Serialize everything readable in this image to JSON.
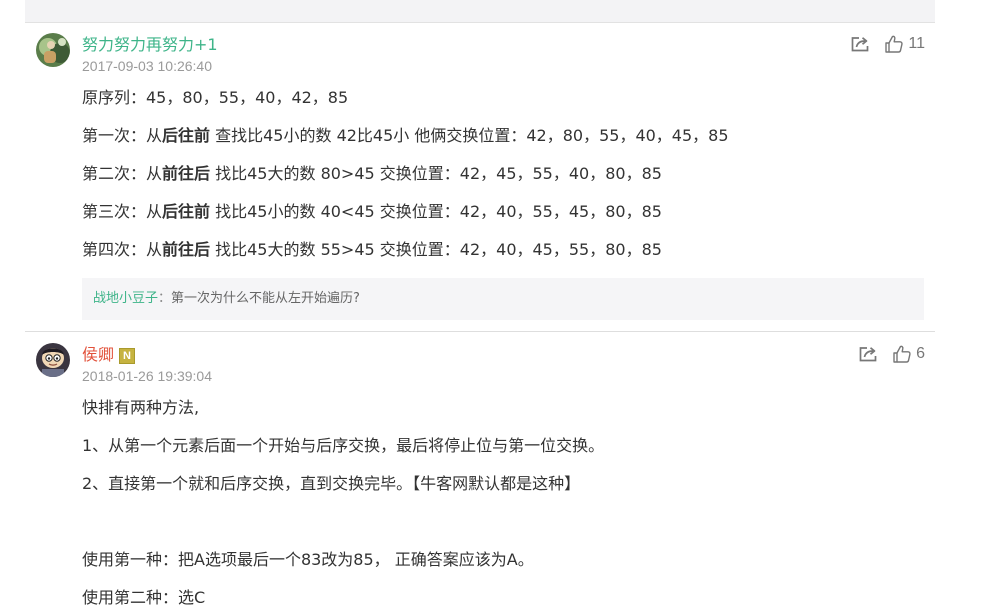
{
  "comments": [
    {
      "username": "努力努力再努力+1",
      "timestamp": "2017-09-03 10:26:40",
      "likes": "11",
      "lines": [
        {
          "pre": "原序列：45，80，55，40，42，85",
          "bold": "",
          "post": ""
        },
        {
          "pre": "第一次：从",
          "bold": "后往前",
          "post": " 查找比45小的数 42比45小 他俩交换位置：42，80，55，40，45，85"
        },
        {
          "pre": "第二次：从",
          "bold": "前往后",
          "post": " 找比45大的数 80>45 交换位置：42，45，55，40，80，85"
        },
        {
          "pre": "第三次：从",
          "bold": "后往前",
          "post": " 找比45小的数 40<45 交换位置：42，40，55，45，80，85"
        },
        {
          "pre": "第四次：从",
          "bold": "前往后",
          "post": " 找比45大的数 55>45 交换位置：42，40，45，55，80，85"
        }
      ],
      "reply": {
        "username": "战地小豆子",
        "separator": "：",
        "text": "第一次为什么不能从左开始遍历?"
      }
    },
    {
      "username": "侯卿",
      "badge": "N",
      "timestamp": "2018-01-26 19:39:04",
      "likes": "6",
      "lines": [
        "快排有两种方法,",
        "1、从第一个元素后面一个开始与后序交换，最后将停止位与第一位交换。",
        "2、直接第一个就和后序交换，直到交换完毕。【牛客网默认都是这种】",
        "使用第一种：把A选项最后一个83改为85， 正确答案应该为A。",
        "使用第二种：选C"
      ]
    }
  ],
  "icons": {
    "share": "share-icon",
    "like": "thumbs-up-icon"
  },
  "colors": {
    "username_green": "#3eb489",
    "username_red": "#e2513a",
    "badge": "#c6b340",
    "reply_bg": "#f5f5f7"
  }
}
